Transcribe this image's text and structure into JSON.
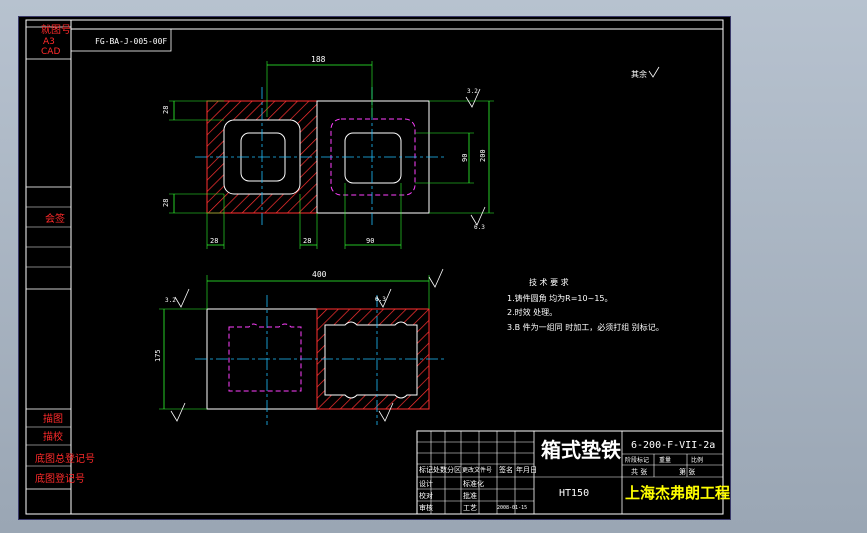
{
  "left_column": {
    "top_labels": [
      "就图号",
      "A3",
      "CAD"
    ],
    "middle_label": "会签",
    "bottom_labels": [
      "描图",
      "描校",
      "底图总登记号",
      "底图登记号"
    ]
  },
  "drawing_number_box": "FG-BA-J-005-00F",
  "roughness_note": "其余",
  "dims": {
    "top_width": "188",
    "left_top": "28",
    "left_bottom": "28",
    "right_inner": "90",
    "right_outer": "200",
    "bottom_a": "28",
    "bottom_b": "28",
    "bottom_c": "90",
    "front_width": "400",
    "front_height": "175",
    "rough_a": "3.2",
    "rough_b": "6.3",
    "rough_c": "6.3",
    "rough_d": "3.2"
  },
  "tech_requirements": {
    "title": "技 术 要 求",
    "lines": [
      "1.铸件圆角 均为R=10~15。",
      "2.时效 处理。",
      "3.B 件为一组同 时加工，必须打组 别标记。"
    ]
  },
  "title_block": {
    "part_name": "箱式垫铁",
    "drawing_code": "6-200-F-VII-2a",
    "material": "HT150",
    "company": "上海杰弗朗工程设备有限公司",
    "sub_labels": [
      "阶段标记",
      "重量",
      "比例"
    ],
    "sheet_labels": [
      "共 张",
      "第 张"
    ],
    "row_labels": [
      "标记",
      "处数",
      "分区",
      "更改文件号",
      "签名",
      "年月日"
    ],
    "role_labels": [
      "设计",
      "标准化",
      "校对",
      "审核",
      "工艺",
      "批准"
    ],
    "date_text": "2008-01-15"
  }
}
